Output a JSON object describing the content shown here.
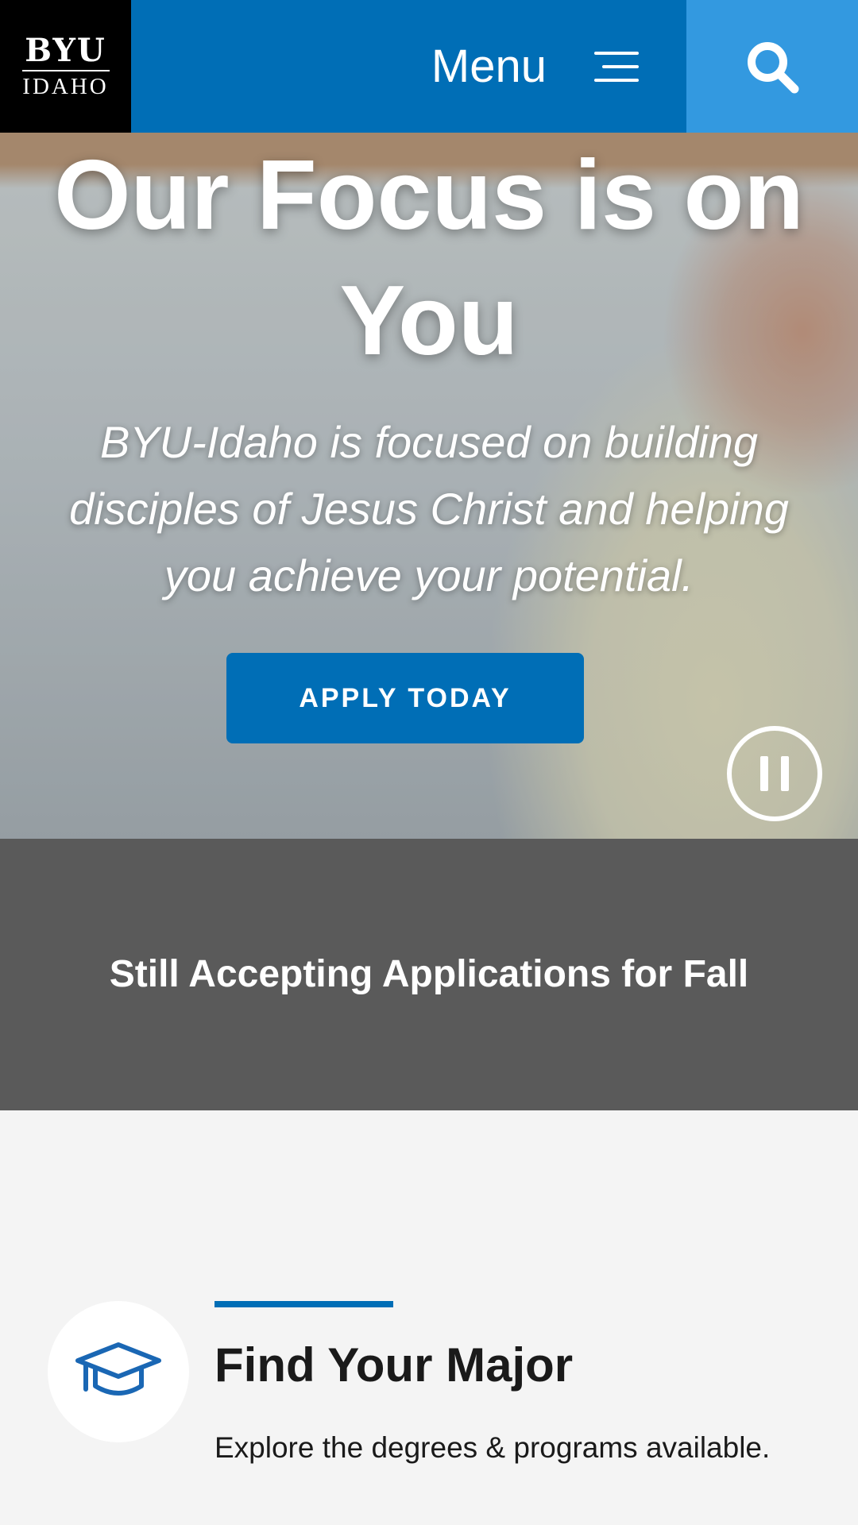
{
  "header": {
    "logo_top": "BYU",
    "logo_bottom": "IDAHO",
    "menu_label": "Menu",
    "menu_icon": "hamburger-icon",
    "search_icon": "search-icon",
    "colors": {
      "menu_bg": "#006eb6",
      "search_bg": "#3399e0",
      "logo_bg": "#000000"
    }
  },
  "hero": {
    "title": "Our Focus is on You",
    "subtitle": "BYU-Idaho is focused on building disciples of Jesus Christ and helping you achieve your potential.",
    "cta_label": "APPLY TODAY",
    "pause_icon": "pause-icon"
  },
  "notice": {
    "text": "Still Accepting Applications for Fall",
    "bg": "#5a5a5a"
  },
  "major": {
    "icon": "graduation-cap-icon",
    "title": "Find Your Major",
    "description": "Explore the degrees & programs available."
  }
}
